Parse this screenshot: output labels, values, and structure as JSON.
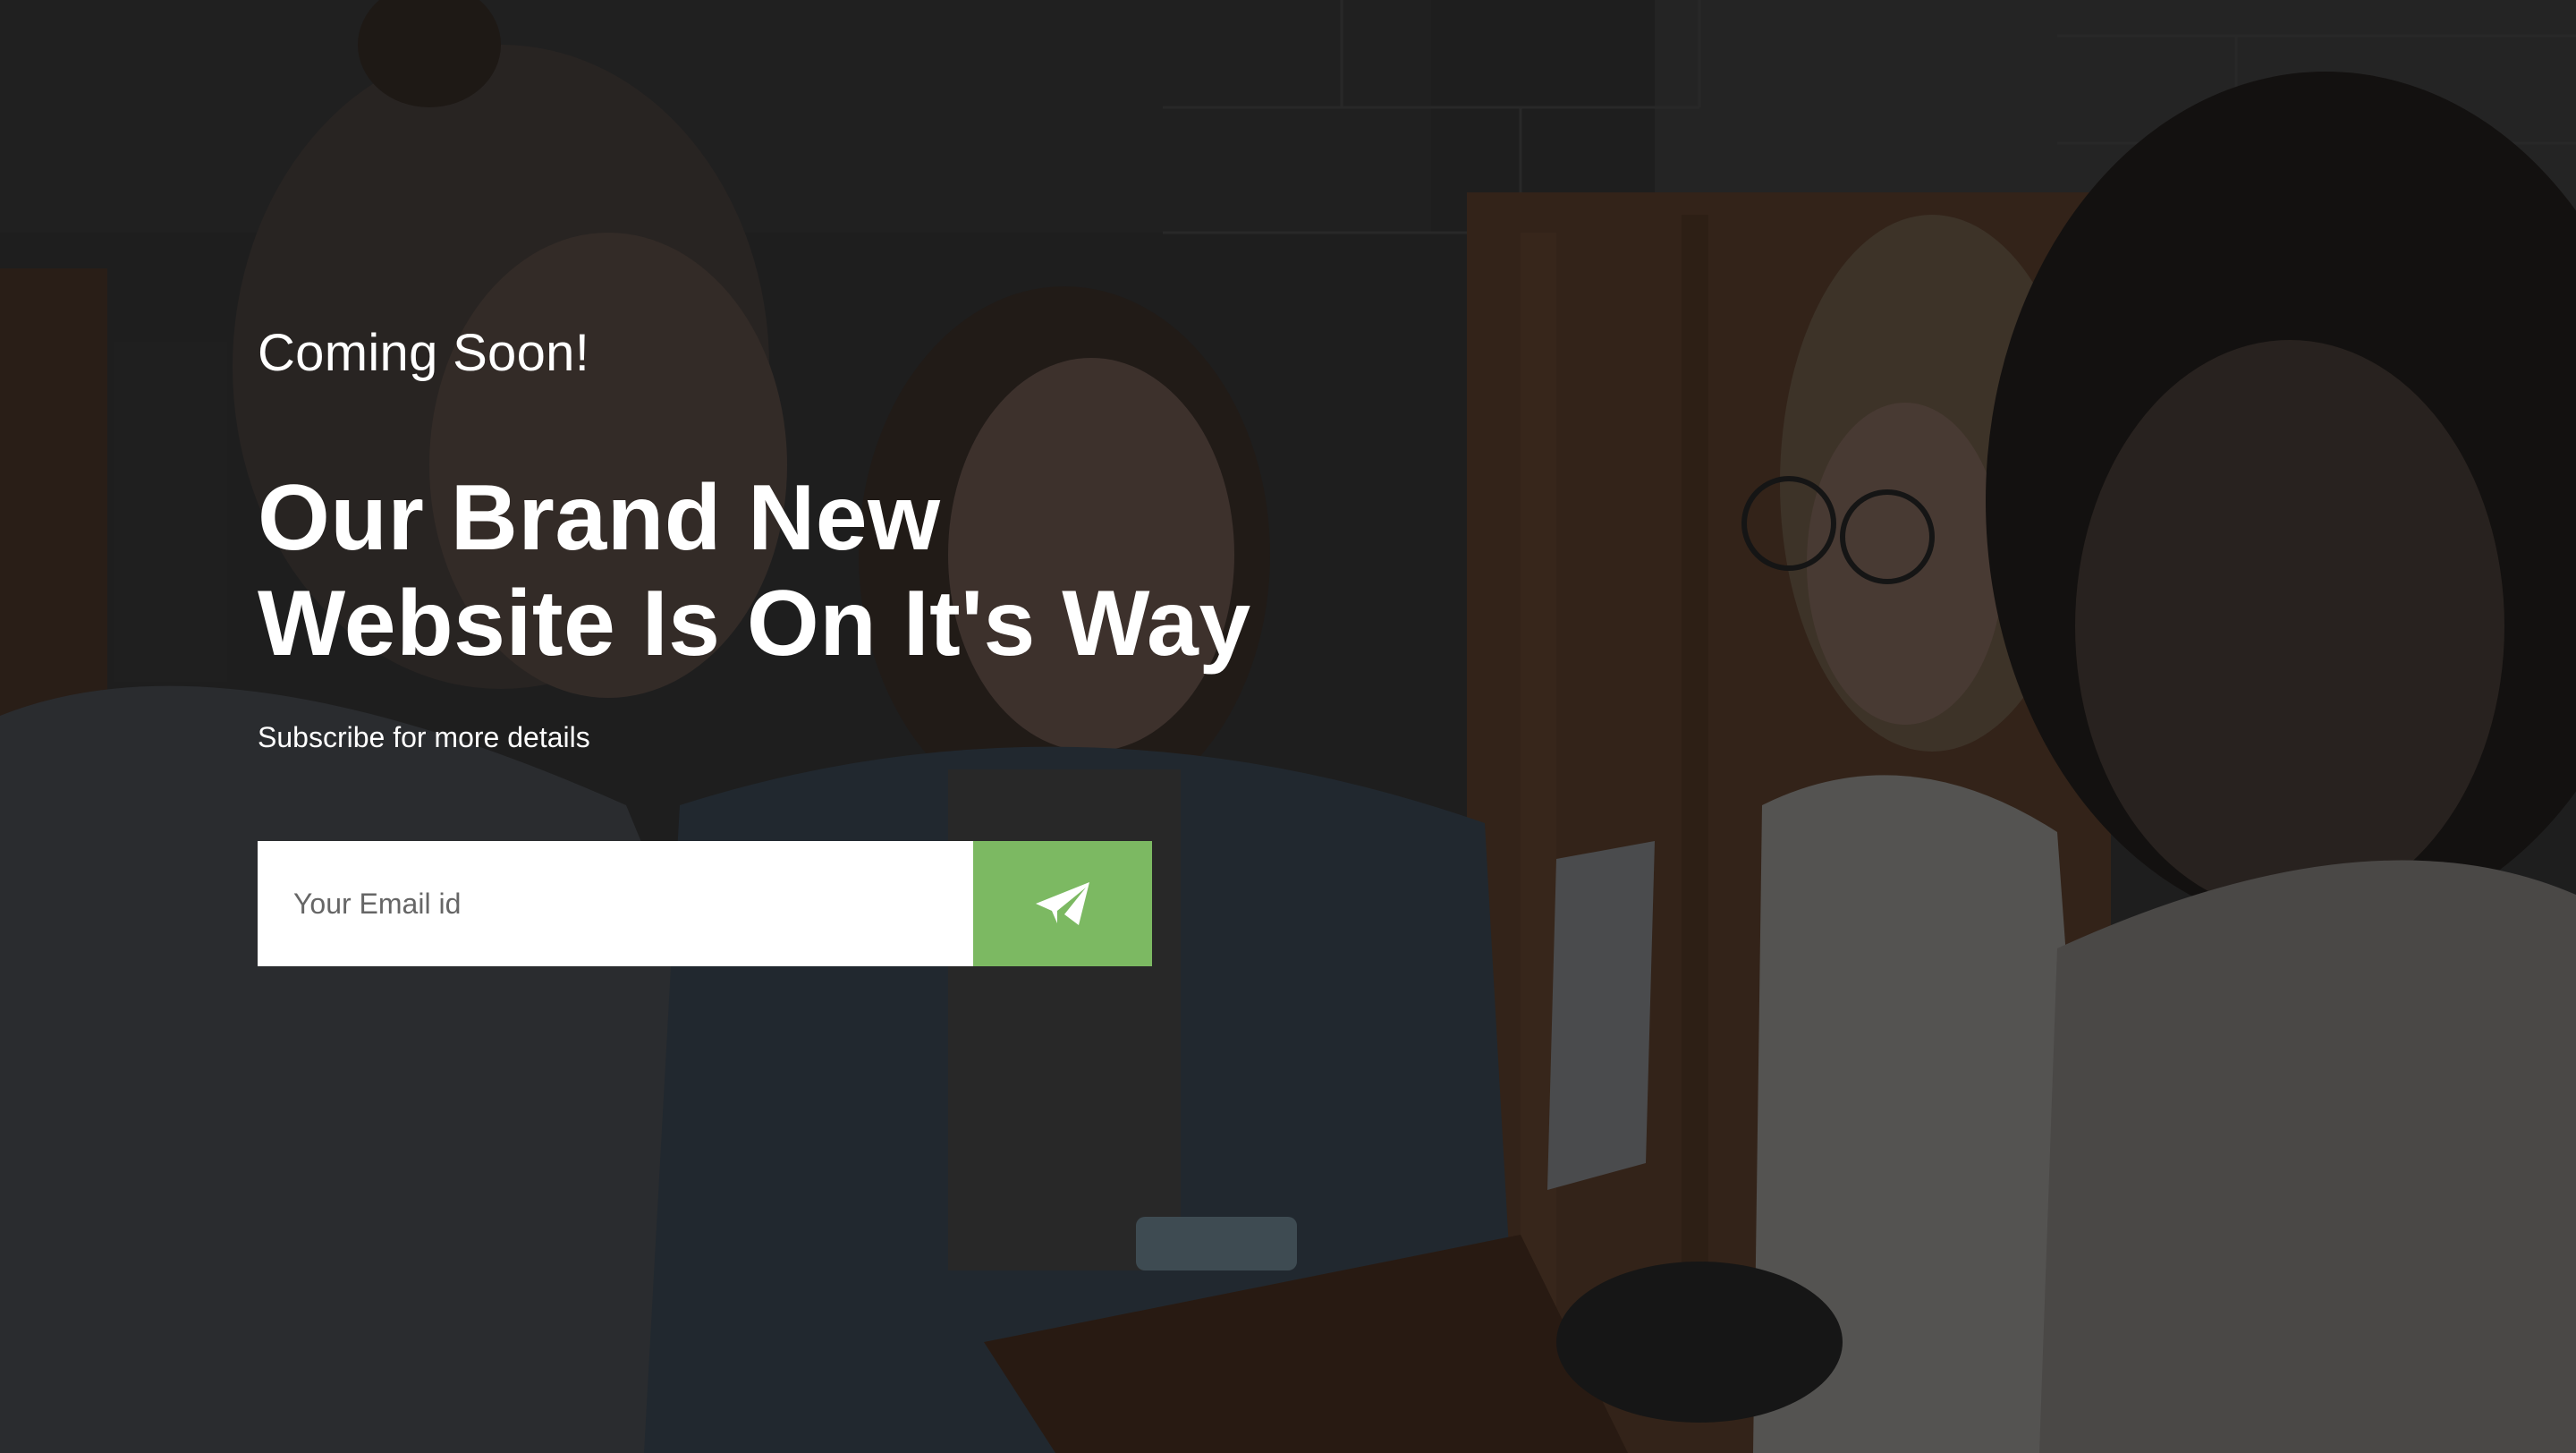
{
  "hero": {
    "eyebrow": "Coming Soon!",
    "headline_line1": "Our Brand New",
    "headline_line2": "Website Is On It's Way",
    "subtext": "Subscribe for more details"
  },
  "subscribe": {
    "email_placeholder": "Your Email id",
    "email_value": "",
    "submit_icon": "paper-plane-icon"
  },
  "colors": {
    "accent": "#7cb962",
    "text": "#ffffff",
    "input_background": "#ffffff",
    "overlay": "#1a1a1a"
  }
}
